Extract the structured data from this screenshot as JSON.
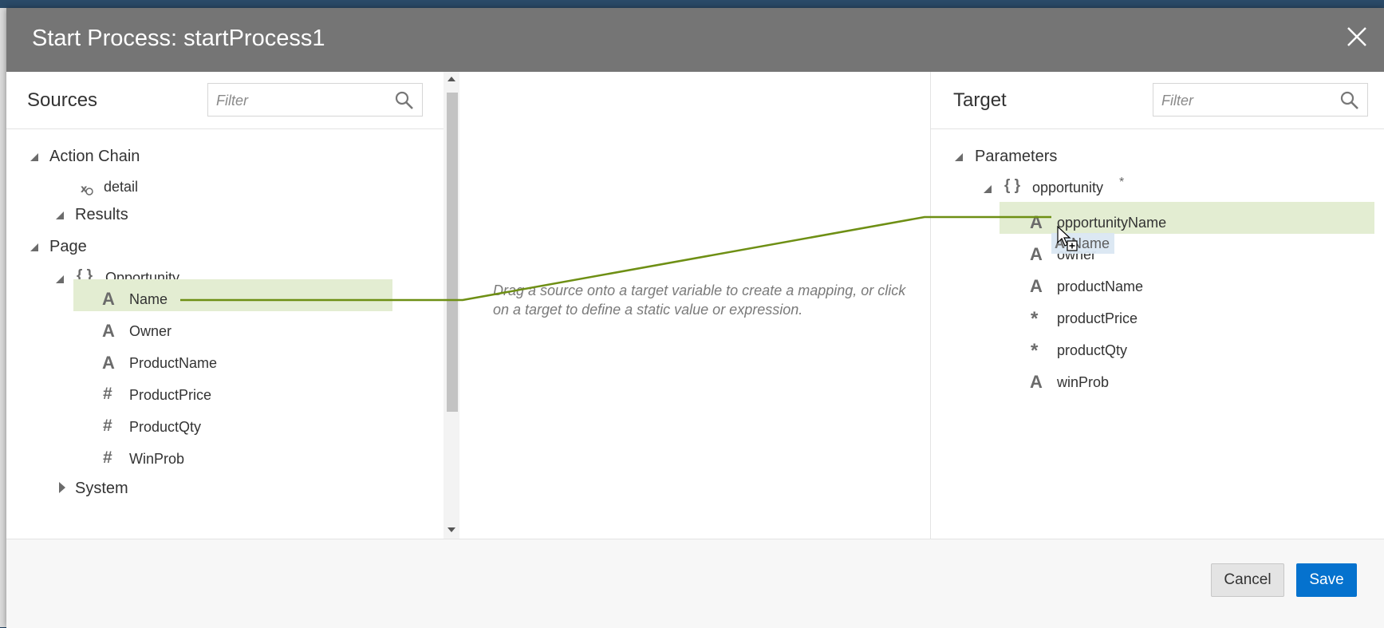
{
  "dialog": {
    "title": "Start Process: startProcess1"
  },
  "sources": {
    "title": "Sources",
    "filter_placeholder": "Filter",
    "tree": {
      "action_chain": "Action Chain",
      "detail": "detail",
      "results": "Results",
      "page": "Page",
      "opportunity": "Opportunity",
      "fields": [
        {
          "type_icon": "A",
          "label": "Name"
        },
        {
          "type_icon": "A",
          "label": "Owner"
        },
        {
          "type_icon": "A",
          "label": "ProductName"
        },
        {
          "type_icon": "#",
          "label": "ProductPrice"
        },
        {
          "type_icon": "#",
          "label": "ProductQty"
        },
        {
          "type_icon": "#",
          "label": "WinProb"
        }
      ],
      "system": "System"
    }
  },
  "middle": {
    "hint": "Drag a source onto a target variable to create a mapping, or click on a target to define a static value or expression."
  },
  "target": {
    "title": "Target",
    "filter_placeholder": "Filter",
    "tree": {
      "parameters": "Parameters",
      "opportunity": "opportunity",
      "required_marker": "*",
      "fields": [
        {
          "type_icon": "A",
          "label": "opportunityName"
        },
        {
          "type_icon": "A",
          "label": "owner"
        },
        {
          "type_icon": "A",
          "label": "productName"
        },
        {
          "type_icon": "*",
          "label": "productPrice"
        },
        {
          "type_icon": "*",
          "label": "productQty"
        },
        {
          "type_icon": "A",
          "label": "winProb"
        }
      ]
    }
  },
  "drag": {
    "label": "Name"
  },
  "footer": {
    "cancel_label": "Cancel",
    "save_label": "Save"
  },
  "colors": {
    "header_bg": "#757575",
    "highlight": "#e3edd2",
    "mapping_line": "#6e8f14",
    "save_button": "#0572ce"
  }
}
